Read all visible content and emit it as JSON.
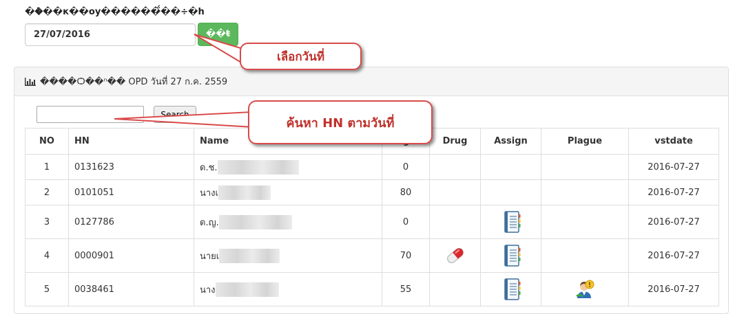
{
  "form": {
    "date_label": "��ܳ��к��оу������̈́��÷�h",
    "date_value": "27/07/2016",
    "submit_label": "��ŧ"
  },
  "panel": {
    "heading_text": "����Ѻ��ⁿ�� OPD วันที่ 27 ก.ค. 2559",
    "heading_icon": "bar-chart-icon"
  },
  "search": {
    "value": "",
    "button_label": "Search"
  },
  "table": {
    "columns": [
      "NO",
      "HN",
      "Name",
      "Age",
      "Drug",
      "Assign",
      "Plague",
      "vstdate"
    ],
    "rows": [
      {
        "no": "1",
        "hn": "0131623",
        "name_prefix": "ด.ช.",
        "age": "0",
        "drug": false,
        "assign": false,
        "plague": false,
        "vstdate": "2016-07-27"
      },
      {
        "no": "2",
        "hn": "0101051",
        "name_prefix": "นางเ",
        "age": "80",
        "drug": false,
        "assign": false,
        "plague": false,
        "vstdate": "2016-07-27"
      },
      {
        "no": "3",
        "hn": "0127786",
        "name_prefix": "ด.ญ.",
        "age": "0",
        "drug": false,
        "assign": true,
        "plague": false,
        "vstdate": "2016-07-27"
      },
      {
        "no": "4",
        "hn": "0000901",
        "name_prefix": "นายเ",
        "age": "70",
        "drug": true,
        "assign": true,
        "plague": false,
        "vstdate": "2016-07-27"
      },
      {
        "no": "5",
        "hn": "0038461",
        "name_prefix": "นาง",
        "age": "55",
        "drug": false,
        "assign": true,
        "plague": true,
        "vstdate": "2016-07-27"
      }
    ]
  },
  "annotations": {
    "callout_date": "เลือกวันที่",
    "callout_search": "ค้นหา HN ตามวันที่",
    "color": "#d94a4a"
  },
  "icons": {
    "drug": "pill-icon",
    "assign": "notebook-icon",
    "plague": "user-alert-icon"
  },
  "colors": {
    "submit_button": "#5cb85c",
    "panel_heading_bg": "#f5f5f5",
    "border": "#dddddd"
  }
}
